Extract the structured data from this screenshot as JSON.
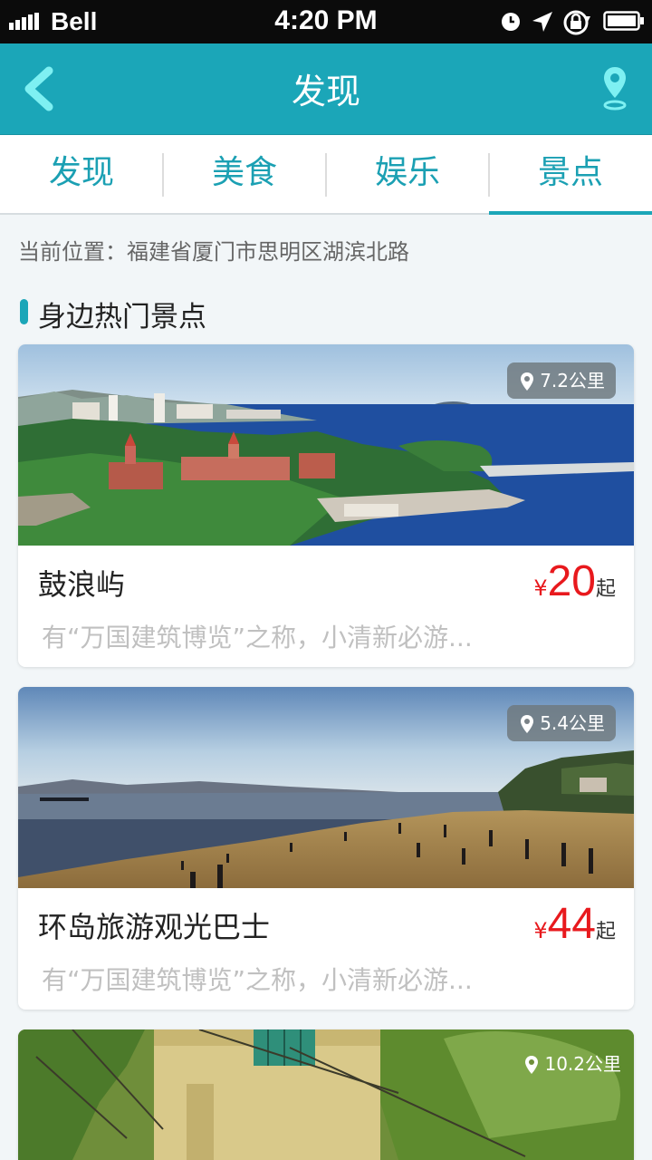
{
  "status_bar": {
    "carrier": "Bell",
    "time": "4:20 PM"
  },
  "nav": {
    "title": "发现"
  },
  "tabs": [
    {
      "label": "发现"
    },
    {
      "label": "美食"
    },
    {
      "label": "娱乐"
    },
    {
      "label": "景点",
      "active": true
    }
  ],
  "current_location": "当前位置：福建省厦门市思明区湖滨北路",
  "section_title": "身边热门景点",
  "places": [
    {
      "distance": "7.2公里",
      "name": "鼓浪屿",
      "currency": "¥",
      "price": "20",
      "price_suffix": "起",
      "desc": "有“万国建筑博览”之称，小清新必游..."
    },
    {
      "distance": "5.4公里",
      "name": "环岛旅游观光巴士",
      "currency": "¥",
      "price": "44",
      "price_suffix": "起",
      "desc": "有“万国建筑博览”之称，小清新必游..."
    },
    {
      "distance": "10.2公里"
    }
  ],
  "colors": {
    "accent": "#1ba6b8",
    "price": "#e8191d",
    "status_bar": "#0b0b0b"
  }
}
